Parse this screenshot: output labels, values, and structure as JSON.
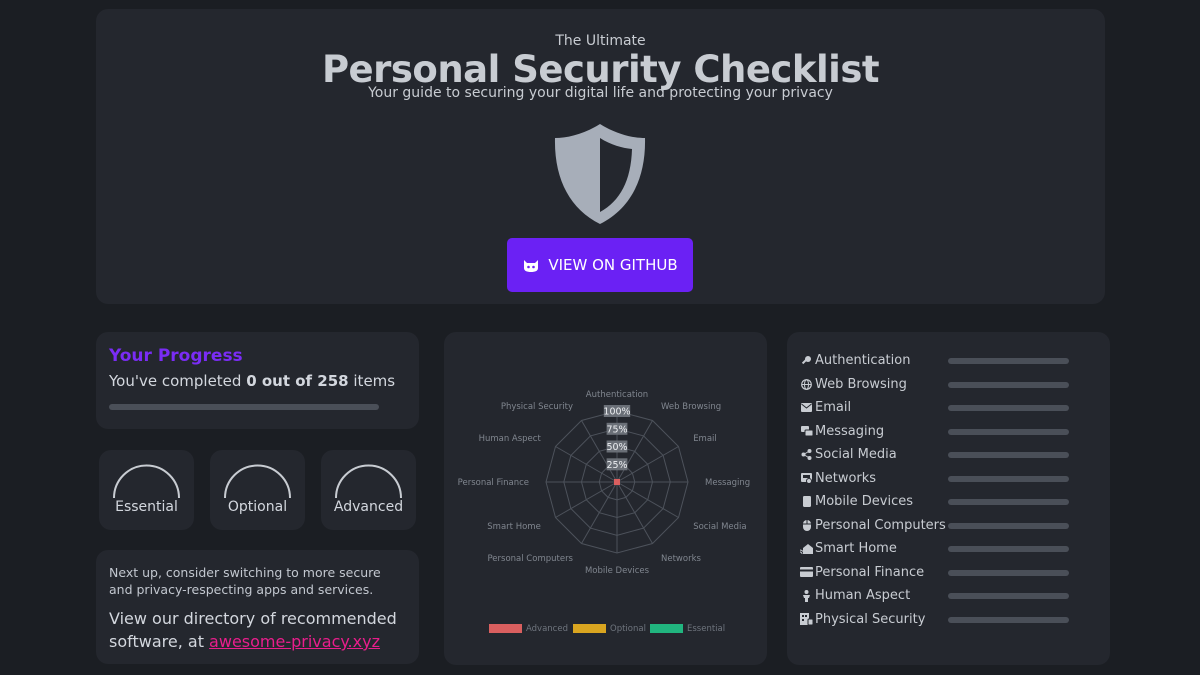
{
  "hero": {
    "subtitle": "The Ultimate",
    "title": "Personal Security Checklist",
    "tagline": "Your guide to securing your digital life and protecting your privacy",
    "github_label": "VIEW ON GITHUB"
  },
  "progress": {
    "title": "Your Progress",
    "prefix": "You've completed ",
    "completed": "0 out of 258",
    "suffix": " items",
    "fraction": 0
  },
  "gauges": [
    {
      "label": "Essential",
      "value": 0
    },
    {
      "label": "Optional",
      "value": 0
    },
    {
      "label": "Advanced",
      "value": 0
    }
  ],
  "next": {
    "text": "Next up, consider switching to more secure and privacy-respecting apps and services.",
    "directory_text": "View our directory of recommended software, at ",
    "directory_link": "awesome-privacy.xyz"
  },
  "chart_data": {
    "type": "radar",
    "categories": [
      "Authentication",
      "Web Browsing",
      "Email",
      "Messaging",
      "Social Media",
      "Networks",
      "Mobile Devices",
      "Personal Computers",
      "Smart Home",
      "Personal Finance",
      "Human Aspect",
      "Physical Security"
    ],
    "ticks": [
      "25%",
      "50%",
      "75%",
      "100%"
    ],
    "range": [
      0,
      100
    ],
    "series": [
      {
        "name": "Advanced",
        "color": "#d95f5f",
        "values": [
          0,
          0,
          0,
          0,
          0,
          0,
          0,
          0,
          0,
          0,
          0,
          0
        ]
      },
      {
        "name": "Optional",
        "color": "#d9a520",
        "values": [
          0,
          0,
          0,
          0,
          0,
          0,
          0,
          0,
          0,
          0,
          0,
          0
        ]
      },
      {
        "name": "Essential",
        "color": "#21b57f",
        "values": [
          0,
          0,
          0,
          0,
          0,
          0,
          0,
          0,
          0,
          0,
          0,
          0
        ]
      }
    ],
    "legend": "bottom"
  },
  "categories": [
    {
      "label": "Authentication",
      "icon": "key-icon",
      "progress": 0
    },
    {
      "label": "Web Browsing",
      "icon": "globe-icon",
      "progress": 0
    },
    {
      "label": "Email",
      "icon": "envelope-icon",
      "progress": 0
    },
    {
      "label": "Messaging",
      "icon": "chat-icon",
      "progress": 0
    },
    {
      "label": "Social Media",
      "icon": "share-icon",
      "progress": 0
    },
    {
      "label": "Networks",
      "icon": "network-icon",
      "progress": 0
    },
    {
      "label": "Mobile Devices",
      "icon": "phone-icon",
      "progress": 0
    },
    {
      "label": "Personal Computers",
      "icon": "mouse-icon",
      "progress": 0
    },
    {
      "label": "Smart Home",
      "icon": "smart-home-icon",
      "progress": 0
    },
    {
      "label": "Personal Finance",
      "icon": "credit-card-icon",
      "progress": 0
    },
    {
      "label": "Human Aspect",
      "icon": "person-icon",
      "progress": 0
    },
    {
      "label": "Physical Security",
      "icon": "building-icon",
      "progress": 0
    }
  ]
}
